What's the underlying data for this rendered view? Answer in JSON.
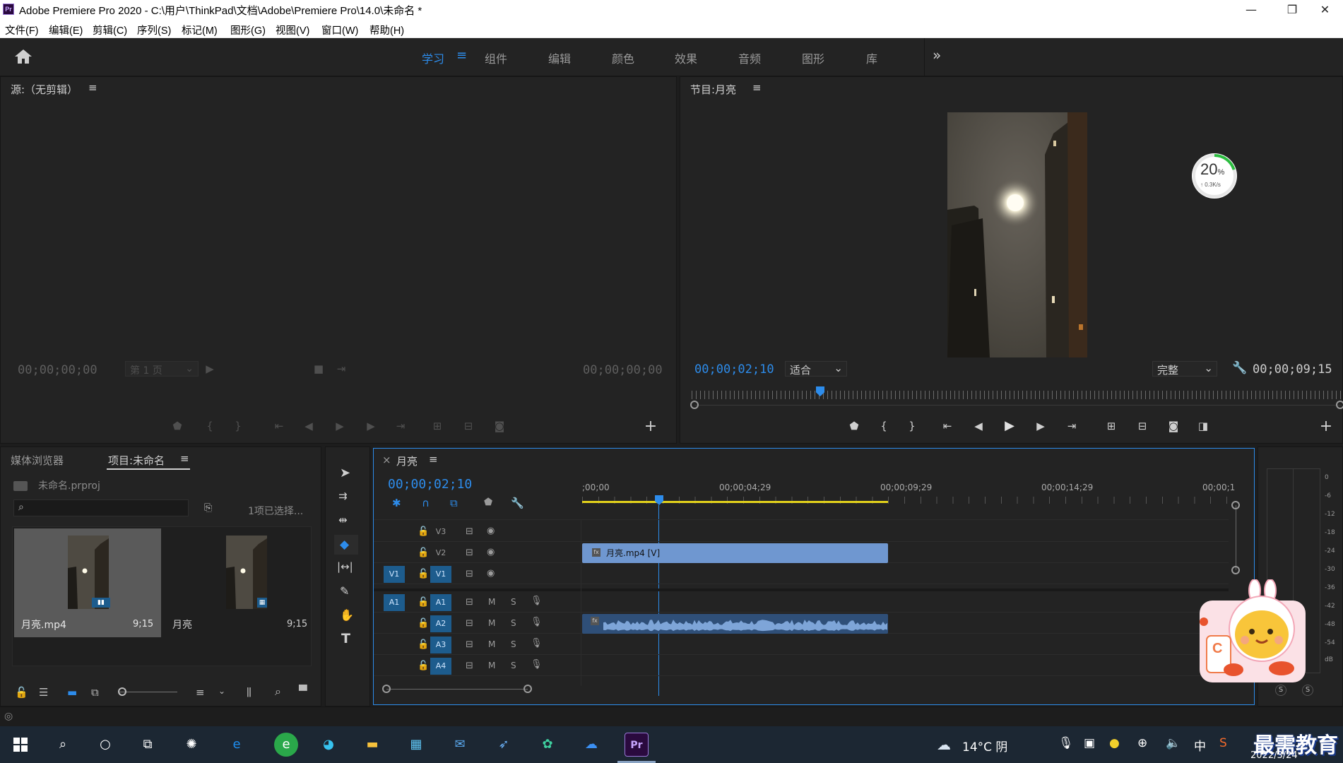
{
  "window": {
    "app_icon": "Pr",
    "title": "Adobe Premiere Pro 2020 - C:\\用户\\ThinkPad\\文档\\Adobe\\Premiere Pro\\14.0\\未命名 *",
    "minimize": "—",
    "maximize": "❐",
    "close": "✕"
  },
  "menu": [
    "文件(F)",
    "编辑(E)",
    "剪辑(C)",
    "序列(S)",
    "标记(M)",
    "图形(G)",
    "视图(V)",
    "窗口(W)",
    "帮助(H)"
  ],
  "workspaces": {
    "tabs": [
      "学习",
      "组件",
      "编辑",
      "颜色",
      "效果",
      "音频",
      "图形",
      "库"
    ],
    "active": "学习",
    "menu_glyph": "≡",
    "overflow": "»"
  },
  "source_monitor": {
    "title": "源:（无剪辑）",
    "menu_glyph": "≡",
    "timecode_left": "00;00;00;00",
    "page_select": "第 1 页",
    "timecode_right": "00;00;00;00",
    "add": "+"
  },
  "program_monitor": {
    "title": "节目:月亮",
    "menu_glyph": "≡",
    "timecode": "00;00;02;10",
    "fit": "适合",
    "quality": "完整",
    "duration": "00;00;09;15",
    "add": "+"
  },
  "network_widget": {
    "percent": "20",
    "percent_sign": "%",
    "speed": "↑ 0.3K/s",
    "progress": 0.2,
    "accent": "#2bbd3f"
  },
  "project_panel": {
    "tabs": [
      "媒体浏览器",
      "项目:未命名"
    ],
    "active_tab": "项目:未命名",
    "menu_glyph": "≡",
    "project_file": "未命名.prproj",
    "search_placeholder": "",
    "selection_info": "1项已选择...",
    "items": [
      {
        "name": "月亮.mp4",
        "duration": "9;15",
        "selected": true
      },
      {
        "name": "月亮",
        "duration": "9;15",
        "selected": false
      }
    ]
  },
  "timeline": {
    "close": "×",
    "sequence_name": "月亮",
    "menu_glyph": "≡",
    "timecode": "00;00;02;10",
    "ruler_labels": [
      ";00;00",
      "00;00;04;29",
      "00;00;09;29",
      "00;00;14;29",
      "00;00;1"
    ],
    "playhead_seconds": 2.33,
    "video_tracks": [
      {
        "name": "V3",
        "source": "",
        "clip": ""
      },
      {
        "name": "V2",
        "source": "",
        "clip": "月亮.mp4 [V]"
      },
      {
        "name": "V1",
        "source": "V1",
        "clip": ""
      }
    ],
    "audio_tracks": [
      {
        "name": "A1",
        "source": "A1",
        "clip": false
      },
      {
        "name": "A2",
        "source": "",
        "clip": true
      },
      {
        "name": "A3",
        "source": "",
        "clip": false
      },
      {
        "name": "A4",
        "source": "",
        "clip": false
      }
    ],
    "m_label": "M",
    "s_label": "S",
    "clip_color": "#6f97d0"
  },
  "audio_meter": {
    "scale": [
      "0",
      "-6",
      "-12",
      "-18",
      "-24",
      "-30",
      "-36",
      "-42",
      "-48",
      "-54",
      "dB"
    ],
    "solo": [
      "S",
      "S"
    ]
  },
  "taskbar": {
    "weather": "14°C 阴",
    "ime": "中",
    "watermark": "最需教育",
    "date": "2022/3/24"
  }
}
